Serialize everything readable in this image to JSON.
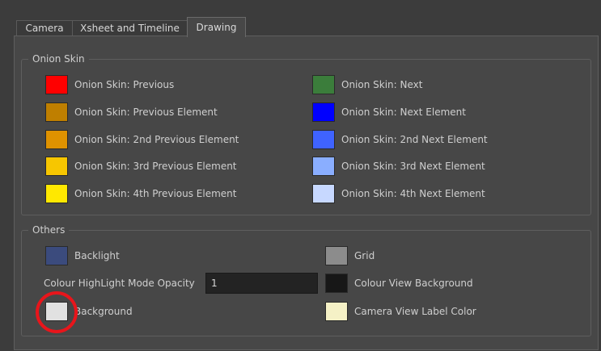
{
  "tabs": [
    {
      "label": "Camera",
      "active": false
    },
    {
      "label": "Xsheet and Timeline",
      "active": false
    },
    {
      "label": "Drawing",
      "active": true
    }
  ],
  "onion_skin": {
    "title": "Onion Skin",
    "left": [
      {
        "label": "Onion Skin: Previous",
        "color": "#ff0000"
      },
      {
        "label": "Onion Skin: Previous Element",
        "color": "#bf7f00"
      },
      {
        "label": "Onion Skin: 2nd Previous Element",
        "color": "#df9200"
      },
      {
        "label": "Onion Skin: 3rd Previous Element",
        "color": "#f7c600"
      },
      {
        "label": "Onion Skin: 4th Previous Element",
        "color": "#ffe800"
      }
    ],
    "right": [
      {
        "label": "Onion Skin: Next",
        "color": "#3b7d3b"
      },
      {
        "label": "Onion Skin: Next Element",
        "color": "#0000ff"
      },
      {
        "label": "Onion Skin: 2nd Next Element",
        "color": "#3f63ff"
      },
      {
        "label": "Onion Skin: 3rd Next Element",
        "color": "#8aaeff"
      },
      {
        "label": "Onion Skin: 4th Next Element",
        "color": "#c7d8ff"
      }
    ]
  },
  "others": {
    "title": "Others",
    "backlight": {
      "label": "Backlight",
      "color": "#3b4b7d"
    },
    "grid": {
      "label": "Grid",
      "color": "#8c8c8c"
    },
    "opacity_label": "Colour HighLight Mode Opacity",
    "opacity_value": "1",
    "colour_view_bg": {
      "label": "Colour View Background",
      "color": "#171717"
    },
    "background": {
      "label": "Background",
      "color": "#e1e1e1"
    },
    "camera_label_color": {
      "label": "Camera View Label Color",
      "color": "#f5f1c6"
    }
  },
  "highlight_color": "#e8151b"
}
